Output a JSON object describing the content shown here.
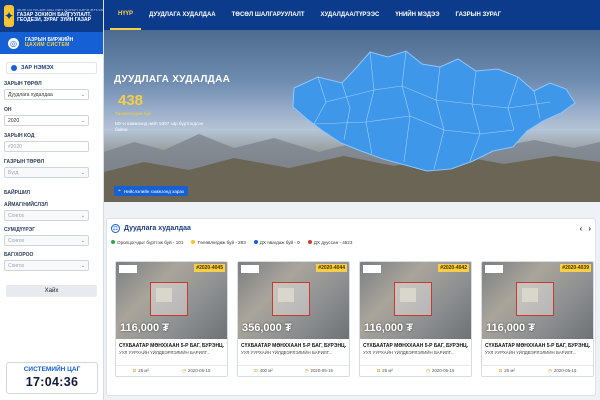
{
  "brand": {
    "line0": "МОНГОЛ УЛСЫН ЗАСГИЙН ГАЗРЫН ХЭРЭГЖҮҮЛЭГЧ АГЕНТЛАГ",
    "line1": "ГАЗАР ЗОХИОН БАЙГУУЛАЛТ,",
    "line2": "ГЕОДЕЗИ, ЗУРАГ ЗҮЙН ГАЗАР",
    "system_line1": "ГАЗРЫН БИРЖИЙН",
    "system_line2": "ЦАХИМ СИСТЕМ"
  },
  "nav": {
    "items": [
      {
        "label": "НҮҮР",
        "active": true
      },
      {
        "label": "ДУУДЛАГА ХУДАЛДАА",
        "active": false
      },
      {
        "label": "ТӨСӨЛ ШАЛГАРУУЛАЛТ",
        "active": false
      },
      {
        "label": "ХУДАЛДАА/ТҮРЭЭС",
        "active": false
      },
      {
        "label": "ҮНИЙН МЭДЭЭ",
        "active": false
      },
      {
        "label": "ГАЗРЫН ЗУРАГ",
        "active": false
      }
    ]
  },
  "filter": {
    "title": "ЗАР НЭМЭХ",
    "type_label": "ЗАРЫН ТӨРӨЛ",
    "type_value": "Дуудлага худалдаа",
    "year_label": "ОН",
    "year_value": "2020",
    "code_label": "ЗАРЫН КОД",
    "code_placeholder": "#2020",
    "land_type_label": "ГАЗРЫН ТӨРӨЛ",
    "land_type_value": "Бүгд",
    "location_title": "БАЙРШИЛ",
    "aimag_label": "АЙМАГ/НИЙСЛЭЛ",
    "aimag_value": "Сонгох",
    "sum_label": "СУМ/ДҮҮРЭГ",
    "sum_value": "Сонгох",
    "bag_label": "БАГ/ХОРОО",
    "bag_value": "Сонгох",
    "search_label": "Хайх"
  },
  "clock": {
    "title": "СИСТЕМИЙН ЦАГ",
    "time": "17:04:36"
  },
  "hero": {
    "title": "ДУУДЛАГА ХУДАЛДАА",
    "count": "438",
    "count_label": "Төлөвлөгдөж буй",
    "description": "МУ-н хэмжээнд нийт 5397 зар бүртгэгдсэн байна",
    "link_label": "Нийслэлийн хэмжээнд харах"
  },
  "listings": {
    "title": "Дуудлага худалдаа",
    "prev_arrow": "‹",
    "next_arrow": "›",
    "legend": [
      {
        "label": "Оролцогчдыг бүртгэж буй - 101",
        "color": "#2fa84f"
      },
      {
        "label": "Төлөвлөгдөж буй - 283",
        "color": "#f6c12e"
      },
      {
        "label": "ДХ явагдаж буй - 0",
        "color": "#1560d4"
      },
      {
        "label": "ДХ дууссан - 4523",
        "color": "#d33b2f"
      }
    ],
    "cards": [
      {
        "code": "#2020-4045",
        "price": "116,000 ₮",
        "title": "СҮХБААТАР МӨНХХААН 5-Р БАГ, БУРЭНЦ...",
        "subtitle": "УУЛ УУРХАЙН ҮЙЛДВЭРЛЭЛИЙН БАРИЛГ...",
        "area": "25 м²",
        "date": "2020-05-15"
      },
      {
        "code": "#2020-4044",
        "price": "356,000 ₮",
        "title": "СҮХБААТАР МӨНХХААН 5-Р БАГ, БУРЭНЦ...",
        "subtitle": "УУЛ УУРХАЙН ҮЙЛДВЭРЛЭЛИЙН БАРИЛГ...",
        "area": "400 м²",
        "date": "2020-05-15"
      },
      {
        "code": "#2020-4042",
        "price": "116,000 ₮",
        "title": "СҮХБААТАР МӨНХХААН 5-Р БАГ, БУРЭНЦ...",
        "subtitle": "УУЛ УУРХАЙН ҮЙЛДВЭРЛЭЛИЙН БАРИЛГ...",
        "area": "25 м²",
        "date": "2020-05-15"
      },
      {
        "code": "#2020-4039",
        "price": "116,000 ₮",
        "title": "СҮХБААТАР МӨНХХААН 5-Р БАГ, БУРЭНЦ...",
        "subtitle": "УУЛ УУРХАЙН ҮЙЛДВЭРЛЭЛИЙН БАРИЛГ...",
        "area": "25 м²",
        "date": "2020-05-15"
      }
    ]
  },
  "colors": {
    "nav_bg": "#0d3b8c",
    "accent_yellow": "#f6cf46",
    "primary_blue": "#1560d4",
    "map_fill": "#3f97ea"
  }
}
